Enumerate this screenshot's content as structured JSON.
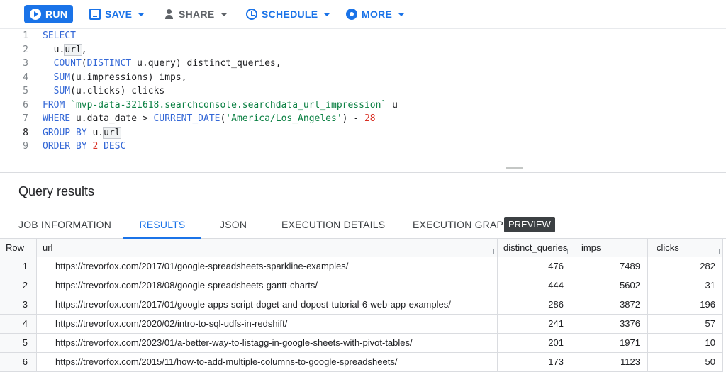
{
  "toolbar": {
    "run_label": "RUN",
    "save_label": "SAVE",
    "share_label": "SHARE",
    "schedule_label": "SCHEDULE",
    "more_label": "MORE",
    "accent_color": "#1a73e8"
  },
  "editor": {
    "line_numbers": [
      "1",
      "2",
      "3",
      "4",
      "5",
      "6",
      "7",
      "8",
      "9"
    ],
    "active_line": "8",
    "lines": [
      [
        {
          "t": "SELECT",
          "c": "kw"
        }
      ],
      [
        {
          "t": "  u.",
          "c": ""
        },
        {
          "t": "url",
          "c": "hl"
        },
        {
          "t": ",",
          "c": ""
        }
      ],
      [
        {
          "t": "  ",
          "c": ""
        },
        {
          "t": "COUNT",
          "c": "fn"
        },
        {
          "t": "(",
          "c": ""
        },
        {
          "t": "DISTINCT",
          "c": "kw"
        },
        {
          "t": " u.query) distinct_queries,",
          "c": ""
        }
      ],
      [
        {
          "t": "  ",
          "c": ""
        },
        {
          "t": "SUM",
          "c": "fn"
        },
        {
          "t": "(u.impressions) imps,",
          "c": ""
        }
      ],
      [
        {
          "t": "  ",
          "c": ""
        },
        {
          "t": "SUM",
          "c": "fn"
        },
        {
          "t": "(u.clicks) clicks",
          "c": ""
        }
      ],
      [
        {
          "t": "FROM",
          "c": "kw"
        },
        {
          "t": " ",
          "c": ""
        },
        {
          "t": "`mvp-data-321618.searchconsole.searchdata_url_impression`",
          "c": "tbl"
        },
        {
          "t": " u",
          "c": ""
        }
      ],
      [
        {
          "t": "WHERE",
          "c": "kw"
        },
        {
          "t": " u.data_date > ",
          "c": ""
        },
        {
          "t": "CURRENT_DATE",
          "c": "fn"
        },
        {
          "t": "(",
          "c": ""
        },
        {
          "t": "'America/Los_Angeles'",
          "c": "str"
        },
        {
          "t": ") - ",
          "c": ""
        },
        {
          "t": "28",
          "c": "num"
        }
      ],
      [
        {
          "t": "GROUP BY",
          "c": "kw"
        },
        {
          "t": " u.",
          "c": ""
        },
        {
          "t": "url",
          "c": "hl"
        }
      ],
      [
        {
          "t": "ORDER BY",
          "c": "kw"
        },
        {
          "t": " ",
          "c": ""
        },
        {
          "t": "2",
          "c": "num"
        },
        {
          "t": " ",
          "c": ""
        },
        {
          "t": "DESC",
          "c": "kw"
        }
      ]
    ]
  },
  "results": {
    "title": "Query results",
    "tabs": [
      "JOB INFORMATION",
      "RESULTS",
      "JSON",
      "EXECUTION DETAILS",
      "EXECUTION GRAPH"
    ],
    "active_tab": "RESULTS",
    "preview_badge": "PREVIEW",
    "columns": [
      "Row",
      "url",
      "distinct_queries",
      "imps",
      "clicks"
    ],
    "rows": [
      [
        "1",
        "https://trevorfox.com/2017/01/google-spreadsheets-sparkline-examples/",
        "476",
        "7489",
        "282"
      ],
      [
        "2",
        "https://trevorfox.com/2018/08/google-spreadsheets-gantt-charts/",
        "444",
        "5602",
        "31"
      ],
      [
        "3",
        "https://trevorfox.com/2017/01/google-apps-script-doget-and-dopost-tutorial-6-web-app-examples/",
        "286",
        "3872",
        "196"
      ],
      [
        "4",
        "https://trevorfox.com/2020/02/intro-to-sql-udfs-in-redshift/",
        "241",
        "3376",
        "57"
      ],
      [
        "5",
        "https://trevorfox.com/2023/01/a-better-way-to-listagg-in-google-sheets-with-pivot-tables/",
        "201",
        "1971",
        "10"
      ],
      [
        "6",
        "https://trevorfox.com/2015/11/how-to-add-multiple-columns-to-google-spreadsheets/",
        "173",
        "1123",
        "50"
      ]
    ]
  }
}
